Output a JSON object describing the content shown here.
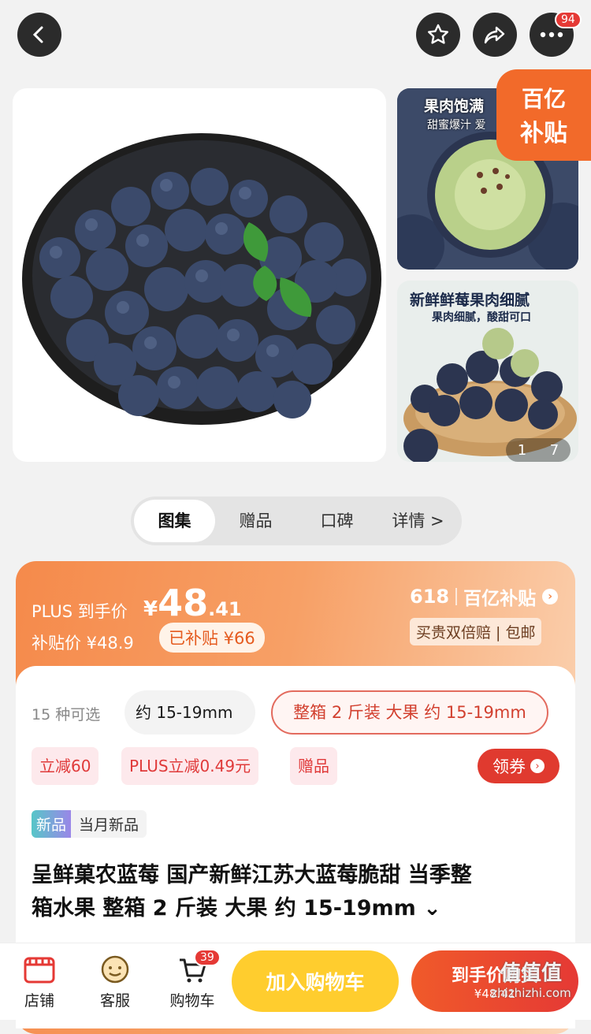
{
  "header": {
    "badge_count": "94"
  },
  "gallery": {
    "subsidy_badge_top": "百亿",
    "subsidy_badge_bottom": "补贴",
    "thumb1_title": "果肉饱满",
    "thumb1_sub": "甜蜜爆汁 爱",
    "thumb2_title": "新鲜鲜莓果肉细腻",
    "thumb2_sub": "果肉细腻，酸甜可口",
    "counter_current": "1",
    "counter_total": "7"
  },
  "tabs": [
    {
      "label": "图集"
    },
    {
      "label": "赠品"
    },
    {
      "label": "口碑"
    },
    {
      "label": "详情 >"
    }
  ],
  "price": {
    "plus_label": "PLUS 到手价",
    "currency": "¥",
    "int": "48",
    "dec": ".41",
    "subsidy_label": "补贴价 ¥48.9",
    "subsidized": "已补贴 ¥66",
    "event": "618",
    "event_brand": "百亿补贴",
    "guarantee": "买贵双倍赔 | 包邮"
  },
  "options": {
    "count_label": "15 种可选",
    "option1": "约 15-19mm",
    "option2": "整箱 2 斤装 大果 约 15-19mm"
  },
  "promos": {
    "p1": "立减60",
    "p2": "PLUS立减0.49元",
    "p3": "赠品",
    "coupon": "领券"
  },
  "tags": {
    "new": "新品",
    "monthly": "当月新品"
  },
  "product": {
    "title_line1": "呈鲜菓农蓝莓 国产新鲜江苏大蓝莓脆甜 当季整",
    "title_line2": "箱水果 整箱 2 斤装 大果 约 15-19mm"
  },
  "bottom": {
    "shop": "店铺",
    "service": "客服",
    "cart": "购物车",
    "cart_count": "39",
    "add_cart": "加入购物车",
    "buy": "到手价购买",
    "buy_price": "¥48.41"
  },
  "watermark": {
    "logo": "值值值",
    "url": "zhizhizhi.com"
  }
}
